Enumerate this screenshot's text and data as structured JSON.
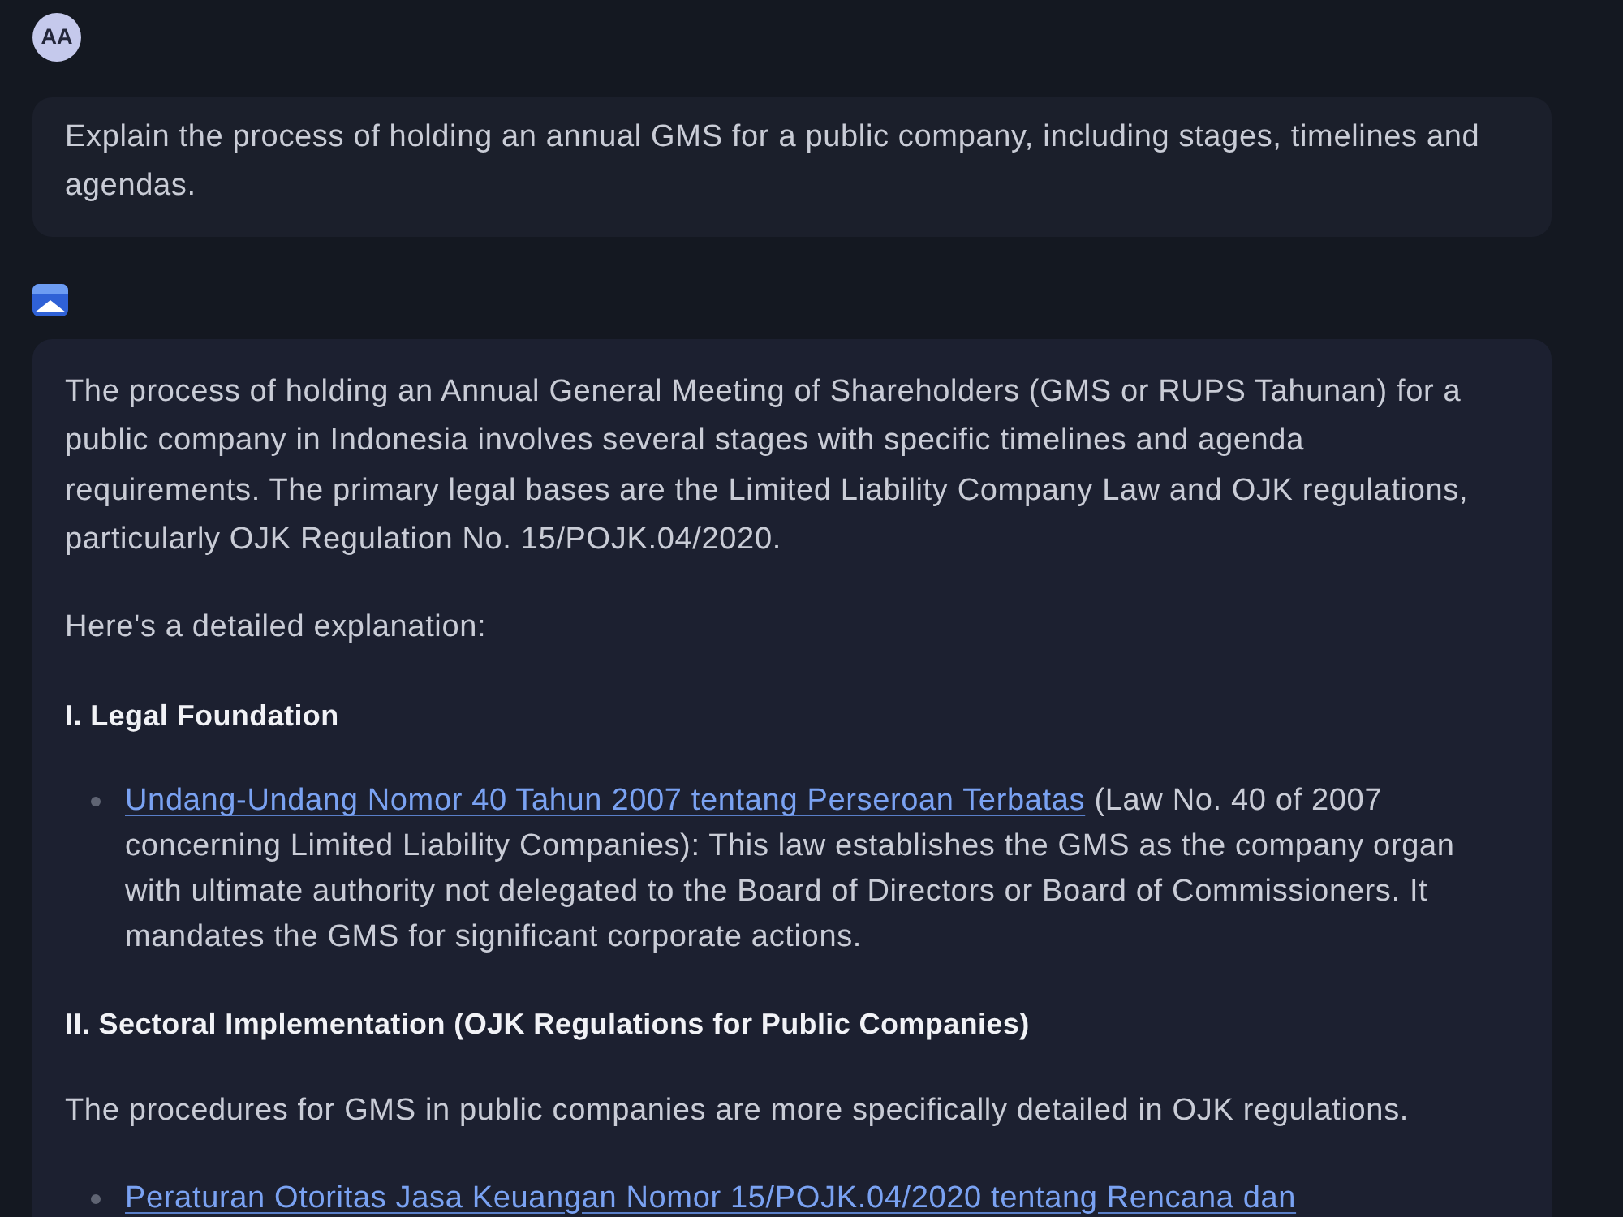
{
  "user_message": {
    "avatar": "AA",
    "text": "Explain the process of holding an annual GMS for a public company, including stages, timelines and agendas."
  },
  "response": {
    "blocks": [
      {
        "kind": "paragraph",
        "text": "The process of holding an Annual General Meeting of Shareholders (GMS or RUPS Tahunan) for a public company in Indonesia involves several stages with specific timelines and agenda requirements. The primary legal bases are the Limited Liability Company Law and OJK regulations, particularly OJK Regulation No. 15/POJK.04/2020."
      },
      {
        "kind": "paragraph",
        "text": "Here's a detailed explanation:"
      },
      {
        "kind": "heading",
        "text": "I. Legal Foundation"
      },
      {
        "kind": "bullets",
        "items": [
          {
            "link": "Undang-Undang Nomor 40 Tahun 2007 tentang Perseroan Terbatas",
            "text": " (Law No. 40 of 2007 concerning Limited Liability Companies): This law establishes the GMS as the company organ with ultimate authority not delegated to the Board of Directors or Board of Commissioners. It mandates the GMS for significant corporate actions."
          }
        ]
      },
      {
        "kind": "heading",
        "text": "II. Sectoral Implementation (OJK Regulations for Public Companies)"
      },
      {
        "kind": "paragraph",
        "text": "The procedures for GMS in public companies are more specifically detailed in OJK regulations."
      },
      {
        "kind": "bullets",
        "items": [
          {
            "link": "Peraturan Otoritas Jasa Keuangan Nomor 15/POJK.04/2020 tentang Rencana dan"
          }
        ]
      }
    ]
  }
}
